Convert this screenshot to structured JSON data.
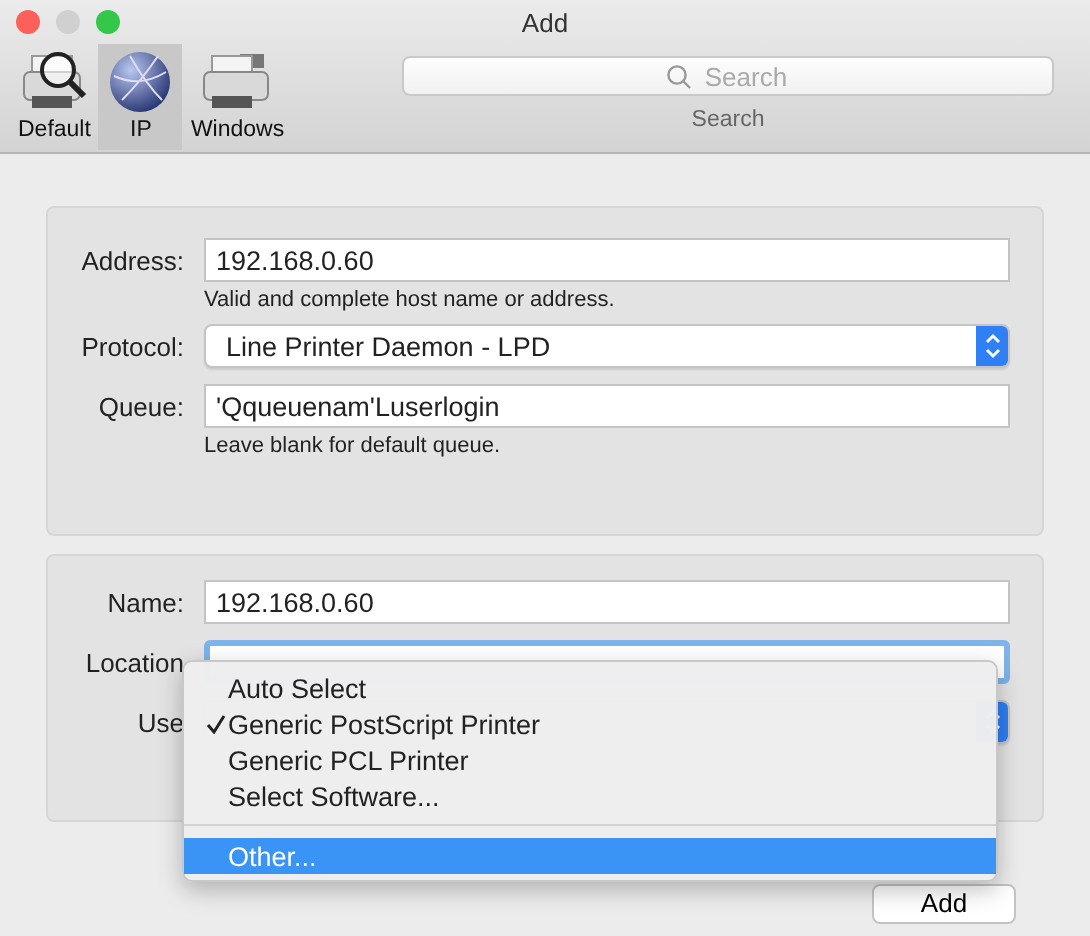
{
  "window": {
    "title": "Add"
  },
  "toolbar": {
    "items": [
      {
        "kind": "default",
        "label": "Default",
        "selected": false
      },
      {
        "kind": "ip",
        "label": "IP",
        "selected": true
      },
      {
        "kind": "windows",
        "label": "Windows",
        "selected": false
      }
    ],
    "search": {
      "placeholder": "Search",
      "label": "Search"
    }
  },
  "connection": {
    "fields": [
      {
        "kind": "text",
        "label": "Address:",
        "value": "192.168.0.60",
        "hint": "Valid and complete host name or address."
      },
      {
        "kind": "popup",
        "label": "Protocol:",
        "value": "Line Printer Daemon - LPD"
      },
      {
        "kind": "text",
        "label": "Queue:",
        "value": "'Qqueuenam'Luserlogin",
        "hint": "Leave blank for default queue."
      }
    ]
  },
  "details": {
    "fields": [
      {
        "kind": "text",
        "label": "Name:",
        "value": "192.168.0.60",
        "focused": false
      },
      {
        "kind": "text",
        "label": "Location",
        "focused": true
      },
      {
        "kind": "popup",
        "label": "Use"
      }
    ]
  },
  "menu": {
    "items": [
      {
        "kind": "item",
        "label": "Auto Select",
        "checked": false,
        "selected": false
      },
      {
        "kind": "item",
        "label": "Generic PostScript Printer",
        "checked": true,
        "selected": false
      },
      {
        "kind": "item",
        "label": "Generic PCL Printer",
        "checked": false,
        "selected": false
      },
      {
        "kind": "item",
        "label": "Select Software...",
        "checked": false,
        "selected": false
      },
      {
        "kind": "separator"
      },
      {
        "kind": "item",
        "label": "Other...",
        "checked": false,
        "selected": true
      }
    ]
  },
  "add_button": {
    "label": "Add"
  }
}
